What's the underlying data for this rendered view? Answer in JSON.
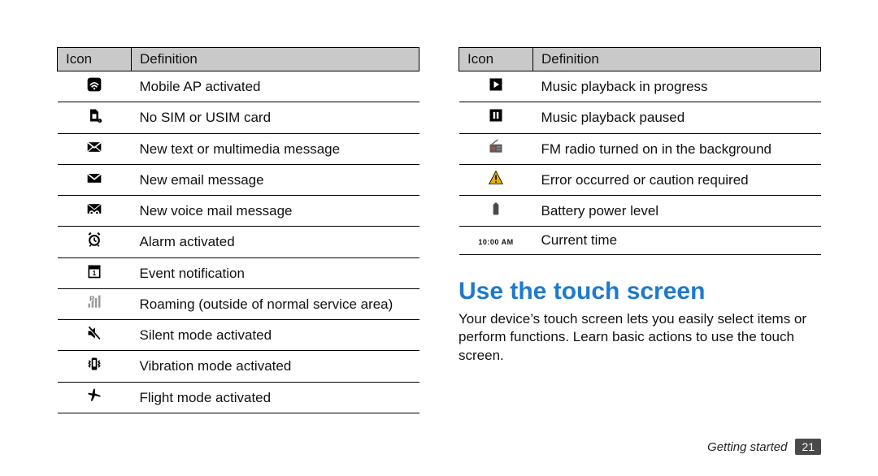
{
  "tableHeader": {
    "icon": "Icon",
    "definition": "Definition"
  },
  "leftRows": [
    {
      "name": "mobile-ap-icon",
      "definition": "Mobile AP activated"
    },
    {
      "name": "no-sim-icon",
      "definition": "No SIM or USIM card"
    },
    {
      "name": "new-message-icon",
      "definition": "New text or multimedia message"
    },
    {
      "name": "new-email-icon",
      "definition": "New email message"
    },
    {
      "name": "voicemail-icon",
      "definition": "New voice mail message"
    },
    {
      "name": "alarm-icon",
      "definition": "Alarm activated"
    },
    {
      "name": "event-icon",
      "definition": "Event notification"
    },
    {
      "name": "roaming-icon",
      "definition": "Roaming (outside of normal service area)"
    },
    {
      "name": "silent-icon",
      "definition": "Silent mode activated"
    },
    {
      "name": "vibration-icon",
      "definition": "Vibration mode activated"
    },
    {
      "name": "flight-icon",
      "definition": "Flight mode activated"
    }
  ],
  "rightRows": [
    {
      "name": "music-play-icon",
      "definition": "Music playback in progress"
    },
    {
      "name": "music-pause-icon",
      "definition": "Music playback paused"
    },
    {
      "name": "fm-radio-icon",
      "definition": "FM radio turned on in the background"
    },
    {
      "name": "warning-icon",
      "definition": "Error occurred or caution required"
    },
    {
      "name": "battery-icon",
      "definition": "Battery power level"
    },
    {
      "name": "time-icon",
      "definition": "Current time",
      "timeLabel": "10:00 AM"
    }
  ],
  "section": {
    "heading": "Use the touch screen",
    "body": "Your device’s touch screen lets you easily select items or perform functions. Learn basic actions to use the touch screen."
  },
  "footer": {
    "section": "Getting started",
    "page": "21"
  }
}
